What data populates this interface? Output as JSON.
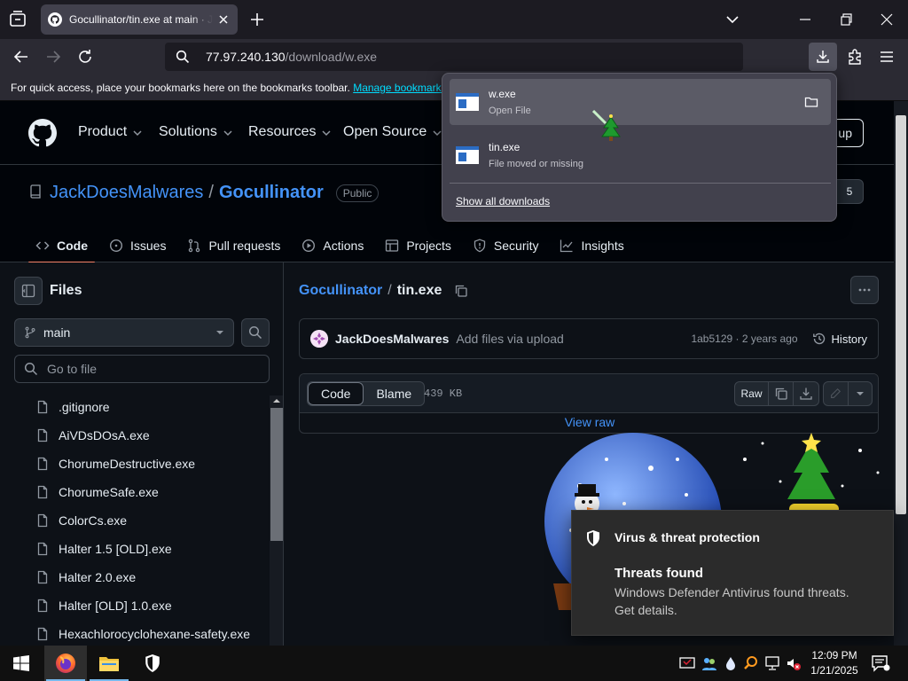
{
  "browser": {
    "tab_title": "Gocullinator/tin.exe at main · JackDoesMalwares/Gocullinator",
    "url_host": "77.97.240.130",
    "url_path": "/download/w.exe",
    "bookmarks_text": "For quick access, place your bookmarks here on the bookmarks toolbar.",
    "bookmarks_link": "Manage bookmarks…"
  },
  "downloads": {
    "items": [
      {
        "name": "w.exe",
        "status": "Open File"
      },
      {
        "name": "tin.exe",
        "status": "File moved or missing"
      }
    ],
    "show_all": "Show all downloads"
  },
  "github": {
    "nav": [
      "Product",
      "Solutions",
      "Resources",
      "Open Source"
    ],
    "signup_label": "up",
    "repo": {
      "owner": "JackDoesMalwares",
      "separator": "/",
      "name": "Gocullinator",
      "visibility": "Public",
      "star_count": "5"
    },
    "tabs": [
      {
        "label": "Code",
        "icon": "code-icon"
      },
      {
        "label": "Issues",
        "icon": "issue-icon"
      },
      {
        "label": "Pull requests",
        "icon": "pull-request-icon"
      },
      {
        "label": "Actions",
        "icon": "play-icon"
      },
      {
        "label": "Projects",
        "icon": "table-icon"
      },
      {
        "label": "Security",
        "icon": "shield-icon"
      },
      {
        "label": "Insights",
        "icon": "graph-icon"
      }
    ],
    "sidebar": {
      "title": "Files",
      "branch": "main",
      "goto_placeholder": "Go to file",
      "files": [
        ".gitignore",
        "AiVDsDOsA.exe",
        "ChorumeDestructive.exe",
        "ChorumeSafe.exe",
        "ColorCs.exe",
        "Halter 1.5 [OLD].exe",
        "Halter 2.0.exe",
        "Halter [OLD] 1.0.exe",
        "Hexachlorocyclohexane-safety.exe"
      ]
    },
    "file_view": {
      "repo": "Gocullinator",
      "separator": "/",
      "file": "tin.exe",
      "commit_author": "JackDoesMalwares",
      "commit_message": "Add files via upload",
      "commit_meta": "1ab5129 · 2 years ago",
      "history_label": "History",
      "tab_code": "Code",
      "tab_blame": "Blame",
      "size": "439 KB",
      "raw_label": "Raw",
      "view_raw": "View raw"
    }
  },
  "toast": {
    "app": "Virus & threat protection",
    "heading": "Threats found",
    "body": "Windows Defender Antivirus found threats. Get details."
  },
  "taskbar": {
    "time": "12:09 PM",
    "date": "1/21/2025"
  },
  "colors": {
    "accent_link": "#4493f8",
    "active_tab_underline": "#f78166",
    "firefox_link": "#00ddff"
  }
}
